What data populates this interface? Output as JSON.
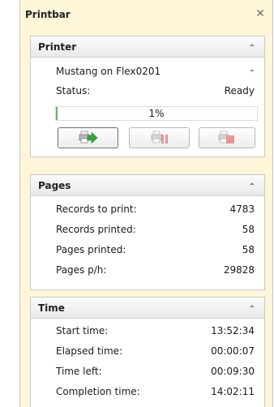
{
  "window": {
    "title": "Printbar",
    "close_icon": "close-icon"
  },
  "printer": {
    "title": "Printer",
    "selected_printer": "Mustang on Flex0201",
    "status_label": "Status:",
    "status_value": "Ready",
    "progress_percent": 1,
    "progress_text": "1%",
    "buttons": [
      {
        "name": "print-button",
        "icon": "print-go-icon",
        "enabled": true
      },
      {
        "name": "pause-button",
        "icon": "print-pause-icon",
        "enabled": false
      },
      {
        "name": "stop-button",
        "icon": "print-stop-icon",
        "enabled": false
      }
    ]
  },
  "pages": {
    "title": "Pages",
    "rows": [
      {
        "label": "Records to print:",
        "value": "4783"
      },
      {
        "label": "Records printed:",
        "value": "58"
      },
      {
        "label": "Pages printed:",
        "value": "58"
      },
      {
        "label": "Pages p/h:",
        "value": "29828"
      }
    ]
  },
  "time": {
    "title": "Time",
    "rows": [
      {
        "label": "Start time:",
        "value": "13:52:34"
      },
      {
        "label": "Elapsed time:",
        "value": "00:00:07"
      },
      {
        "label": "Time left:",
        "value": "00:09:30"
      },
      {
        "label": "Completion time:",
        "value": "14:02:11"
      }
    ]
  },
  "colors": {
    "window_background": "#fdf6d8",
    "progress_fill": "#5cb85c",
    "go_arrow": "#3aa63a",
    "stop_red": "#d84a4a"
  }
}
